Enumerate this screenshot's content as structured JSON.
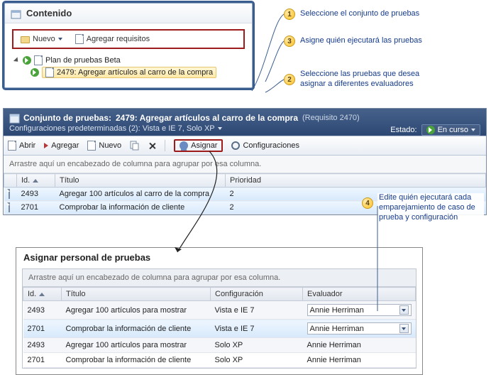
{
  "contenido": {
    "title": "Contenido",
    "toolbar": {
      "nuevo": "Nuevo",
      "agregar_requisitos": "Agregar requisitos"
    },
    "tree": {
      "plan": "Plan de pruebas Beta",
      "suite": "2479: Agregar artículos al carro de la compra"
    }
  },
  "suite": {
    "prefix": "Conjunto de pruebas:",
    "name": "2479: Agregar artículos al carro de la compra",
    "req": "(Requisito 2470)",
    "configs_label": "Configuraciones predeterminadas (2): Vista e IE 7, Solo XP",
    "estado_label": "Estado:",
    "estado_value": "En curso"
  },
  "suite_toolbar": {
    "abrir": "Abrir",
    "agregar": "Agregar",
    "nuevo": "Nuevo",
    "asignar": "Asignar",
    "config": "Configuraciones"
  },
  "group_hint": "Arrastre aquí un encabezado de columna para agrupar por esa columna.",
  "grid": {
    "headers": {
      "id": "Id.",
      "titulo": "Título",
      "prioridad": "Prioridad"
    },
    "rows": [
      {
        "id": "2493",
        "titulo": "Agregar 100 artículos al carro de la compra",
        "prioridad": "2"
      },
      {
        "id": "2701",
        "titulo": "Comprobar la información de cliente",
        "prioridad": "2"
      }
    ]
  },
  "assign": {
    "title": "Asignar personal de pruebas",
    "headers": {
      "id": "Id.",
      "titulo": "Título",
      "config": "Configuración",
      "evaluador": "Evaluador"
    },
    "rows": [
      {
        "id": "2493",
        "titulo": "Agregar 100 artículos para mostrar",
        "config": "Vista e IE 7",
        "evaluador": "Annie Herriman",
        "combo": true,
        "sel": false
      },
      {
        "id": "2701",
        "titulo": "Comprobar la información de cliente",
        "config": "Vista e IE 7",
        "evaluador": "Annie Herriman",
        "combo": true,
        "sel": true
      },
      {
        "id": "2493",
        "titulo": "Agregar 100 artículos para mostrar",
        "config": "Solo XP",
        "evaluador": "Annie Herriman",
        "combo": false,
        "sel": false
      },
      {
        "id": "2701",
        "titulo": "Comprobar la información de cliente",
        "config": "Solo XP",
        "evaluador": "Annie Herriman",
        "combo": false,
        "sel": false
      }
    ]
  },
  "callouts": {
    "c1": "Seleccione el conjunto de pruebas",
    "c2": "Seleccione las pruebas que desea asignar a diferentes evaluadores",
    "c3": "Asigne quién ejecutará las pruebas",
    "c4": "Edite quién ejecutará cada emparejamiento de caso de prueba y configuración"
  }
}
